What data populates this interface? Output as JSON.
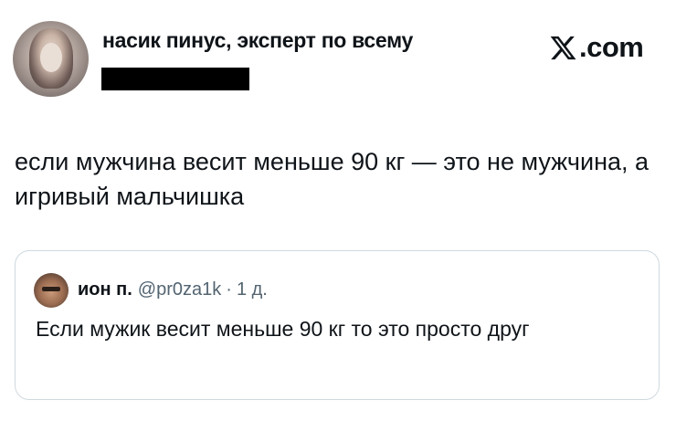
{
  "author": {
    "name": "насик пинус, эксперт по всему"
  },
  "brand": {
    "label": ".com",
    "icon": "x-logo-icon"
  },
  "tweet": {
    "text": "если мужчина весит меньше 90 кг — это не мужчина, а игривый мальчишка"
  },
  "quoted": {
    "name": "ион п.",
    "handle": "@pr0za1k",
    "separator": "·",
    "time": "1 д.",
    "text": "Если мужик весит меньше 90 кг то это просто друг"
  },
  "colors": {
    "text": "#0f1419",
    "muted": "#536471",
    "border": "#cfd9de"
  }
}
